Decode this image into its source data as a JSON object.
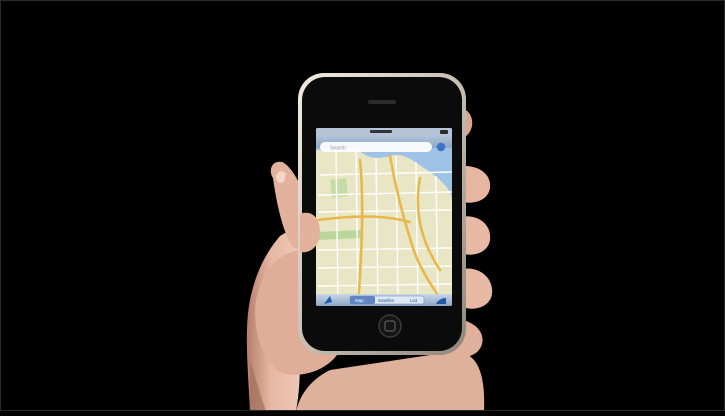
{
  "scene": {
    "subject": "hand holding phone showing map app",
    "background_color": "#000000"
  },
  "phone": {
    "status_bar": {
      "time": ""
    },
    "search": {
      "placeholder": "Search"
    },
    "toolbar": {
      "left_icon": "location-arrow",
      "right_icon": "page-curl"
    },
    "tabs": [
      {
        "label": "Map"
      },
      {
        "label": "Satellite"
      },
      {
        "label": "List"
      }
    ]
  },
  "colors": {
    "map_land": "#e9e6c6",
    "map_water": "#9fc3e6",
    "road_major": "#e8b84a",
    "bezel": "#0b0b0b",
    "chrome": "#d8d0c4",
    "skin": "#e8b9a4"
  }
}
